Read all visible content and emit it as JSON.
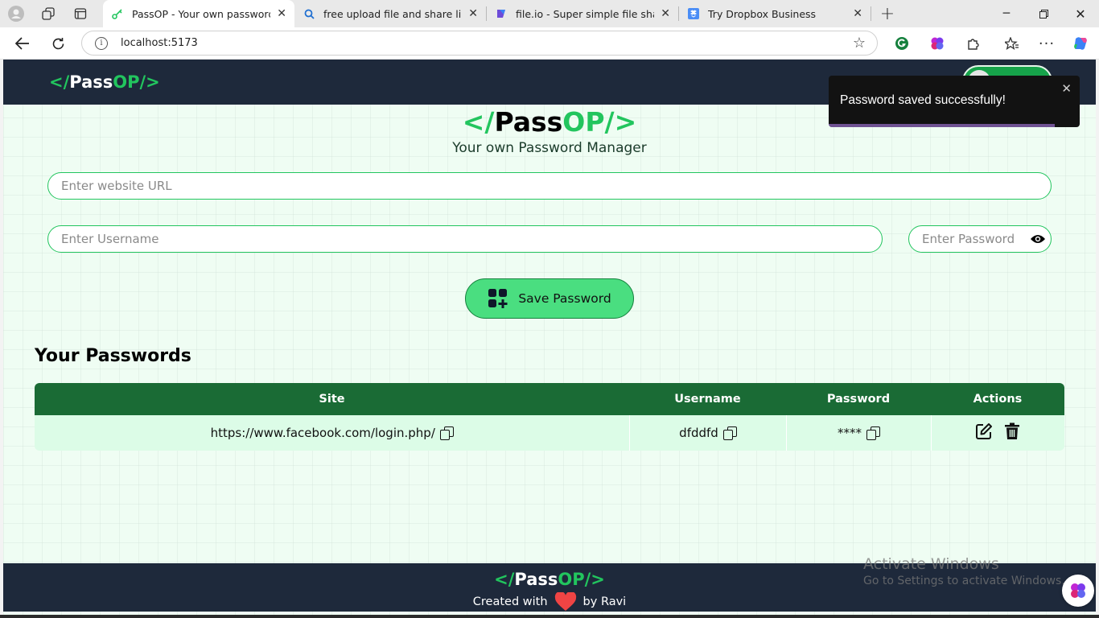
{
  "browser": {
    "tabs": [
      {
        "title": "PassOP - Your own password man",
        "active": true,
        "icon": "key-icon"
      },
      {
        "title": "free upload file and share link - Se",
        "active": false,
        "icon": "search-icon"
      },
      {
        "title": "file.io - Super simple file sharing",
        "active": false,
        "icon": "fileio-icon"
      },
      {
        "title": "Try Dropbox Business",
        "active": false,
        "icon": "dropbox-icon"
      }
    ],
    "address": "localhost:5173"
  },
  "app": {
    "nav_logo": {
      "open": "</",
      "pass": "Pass",
      "op": "OP/>"
    },
    "hero": {
      "open": "</",
      "pass": "Pass",
      "op": "OP/>",
      "subtitle": "Your own Password Manager"
    },
    "form": {
      "url_placeholder": "Enter website URL",
      "username_placeholder": "Enter Username",
      "password_placeholder": "Enter Password",
      "save_label": "Save Password"
    },
    "passwords": {
      "title": "Your Passwords",
      "columns": [
        "Site",
        "Username",
        "Password",
        "Actions"
      ],
      "rows": [
        {
          "site": "https://www.facebook.com/login.php/",
          "username": "dfddfd",
          "password": "****"
        }
      ]
    },
    "footer": {
      "open": "</",
      "pass": "Pass",
      "op": "OP/>",
      "created_with": "Created with",
      "by": "by Ravi"
    }
  },
  "toast": {
    "message": "Password saved successfully!",
    "progress": 0.9
  },
  "watermark": {
    "line1": "Activate Windows",
    "line2": "Go to Settings to activate Windows."
  },
  "colors": {
    "accent": "#22c55e",
    "navbar": "#1e293b",
    "table_header": "#1a6b35",
    "row_bg": "#dcfce7"
  }
}
